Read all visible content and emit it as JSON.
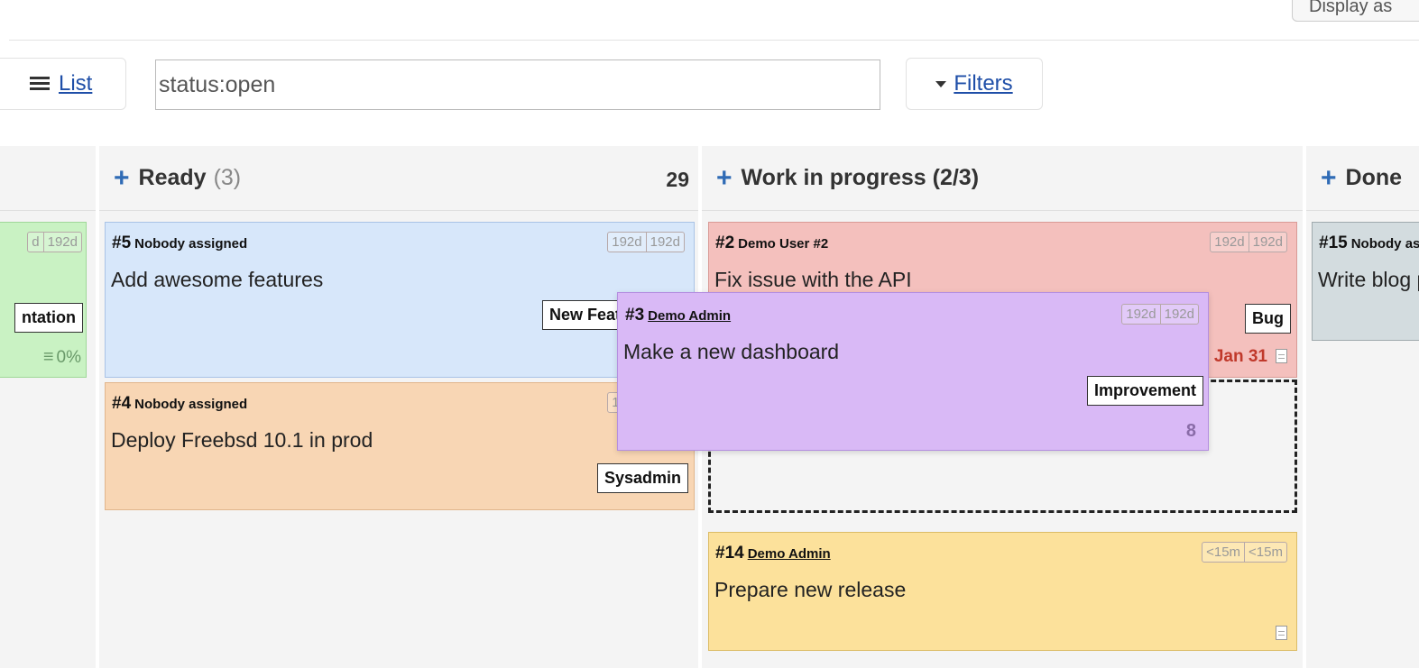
{
  "header": {
    "display_button_label": "Display as",
    "list_button_label": "List",
    "search_value": "status:open",
    "filters_button_label": "Filters"
  },
  "columns": [
    {
      "name": "Ready",
      "count": "(3)",
      "score": "29"
    },
    {
      "name": "Work in progress (2/3)"
    },
    {
      "name": "Done"
    }
  ],
  "left_card": {
    "age": [
      "d",
      "192d"
    ],
    "tag": "ntation",
    "progress": "0%"
  },
  "cards": {
    "c5": {
      "id": "#5",
      "user": "Nobody assigned",
      "title": "Add awesome features",
      "age": [
        "192d",
        "192d"
      ],
      "tag": "New Feature"
    },
    "c4": {
      "id": "#4",
      "user": "Nobody assigned",
      "title": "Deploy Freebsd 10.1 in prod",
      "age": [
        "192d",
        "192d"
      ],
      "tag": "Sysadmin"
    },
    "c2": {
      "id": "#2",
      "user": "Demo User #2",
      "title": "Fix issue with the API",
      "age": [
        "192d",
        "192d"
      ],
      "tag": "Bug",
      "due": "Jan 31"
    },
    "c3": {
      "id": "#3",
      "user": "Demo Admin",
      "title": "Make a new dashboard",
      "age": [
        "192d",
        "192d"
      ],
      "tag": "Improvement",
      "score": "8"
    },
    "c14": {
      "id": "#14",
      "user": "Demo Admin",
      "title": "Prepare new release",
      "age": [
        "<15m",
        "<15m"
      ]
    },
    "c15": {
      "id": "#15",
      "user": "Nobody assigned",
      "title": "Write blog post"
    }
  },
  "colors": {
    "ready_card": "#d7e7fa",
    "deploy_card": "#f8d6b4",
    "bug_card": "#f4c0bd",
    "dragged_card": "#d9b9f6",
    "release_card": "#fce19b",
    "done_card": "#d3dcdf",
    "left_card": "#c9f2c3",
    "link": "#1f4fa8",
    "add_icon": "#2f6bb5",
    "due_date": "#c0392b"
  },
  "icons": [
    "list-icon",
    "caret-down-icon",
    "plus-icon",
    "menu-icon",
    "document-icon"
  ]
}
